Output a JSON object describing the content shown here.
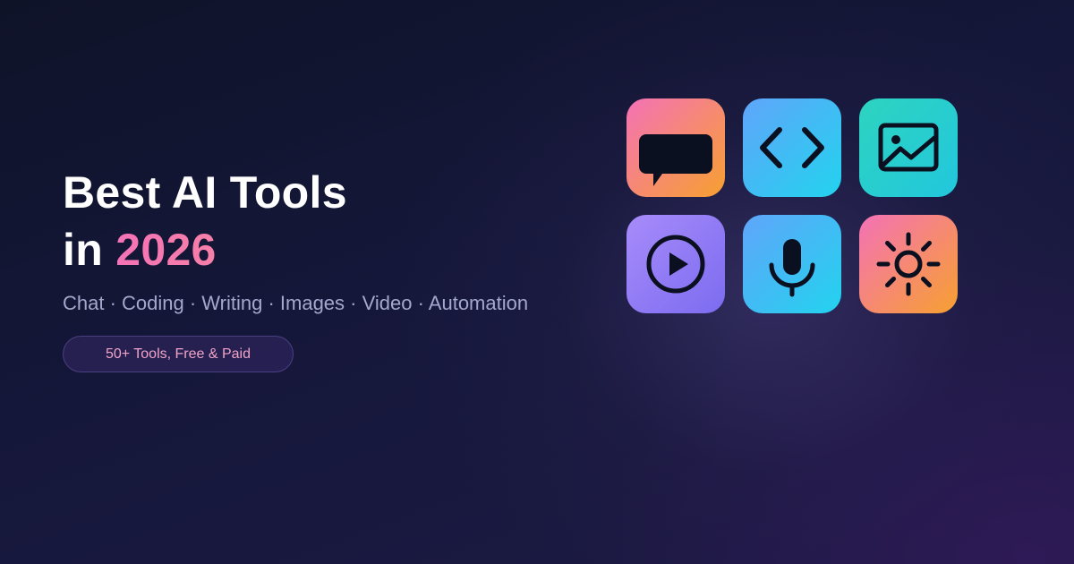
{
  "hero": {
    "title_line1": "Best AI Tools",
    "title_in": "in ",
    "title_year": "2026",
    "subtitle": "Chat · Coding · Writing · Images · Video · Automation",
    "badge": "50+ Tools, Free & Paid"
  },
  "icons": [
    {
      "name": "chat-icon",
      "gradient": [
        "#f472b6",
        "#f7a030"
      ]
    },
    {
      "name": "code-icon",
      "gradient": [
        "#60a5fa",
        "#22d3ee"
      ]
    },
    {
      "name": "image-icon",
      "gradient": [
        "#2dd4bf",
        "#22c7dd"
      ]
    },
    {
      "name": "video-play-icon",
      "gradient": [
        "#a78bfa",
        "#7c6cf0"
      ]
    },
    {
      "name": "microphone-icon",
      "gradient": [
        "#60a5fa",
        "#22d3ee"
      ]
    },
    {
      "name": "sun-icon",
      "gradient": [
        "#f472b6",
        "#f7a030"
      ]
    }
  ],
  "colors": {
    "accent_pink": "#f472b6",
    "icon_stroke": "#0b1020",
    "subtitle": "#a3a8cc"
  }
}
